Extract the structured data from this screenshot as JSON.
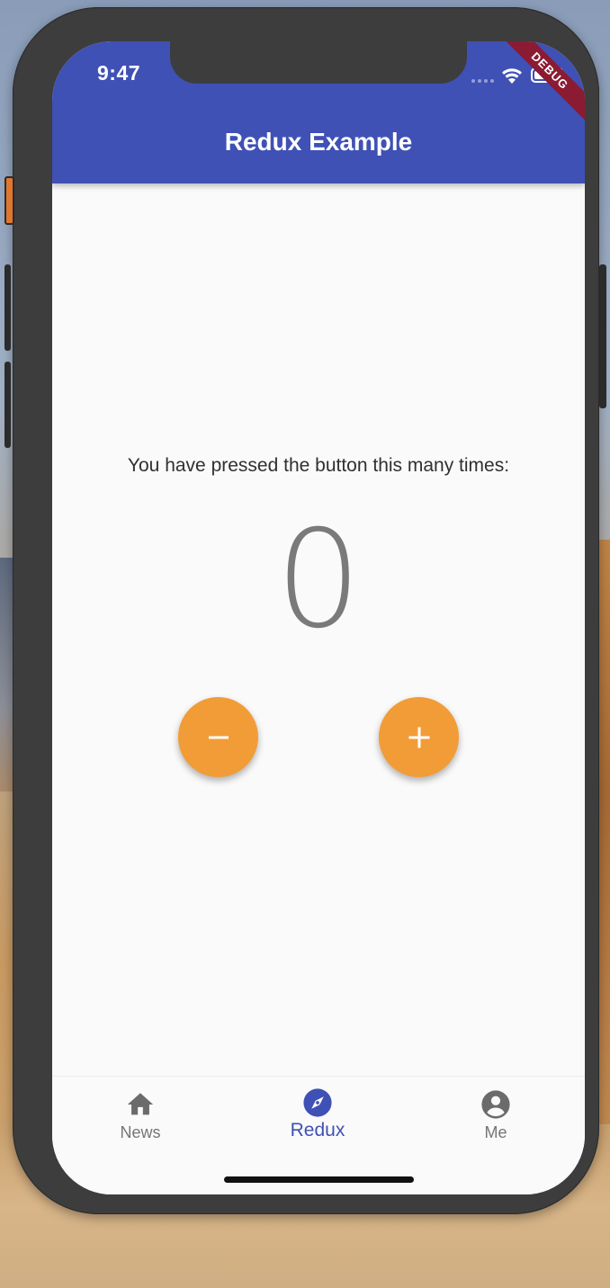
{
  "status_bar": {
    "time": "9:47",
    "icons": [
      "signal-icon",
      "wifi-icon",
      "battery-icon"
    ]
  },
  "debug_banner": "DEBUG",
  "app_bar": {
    "title": "Redux Example"
  },
  "counter": {
    "caption": "You have pressed the button this many times:",
    "value": "0"
  },
  "actions": {
    "decrement_icon": "minus-icon",
    "increment_icon": "plus-icon"
  },
  "bottom_nav": {
    "items": [
      {
        "label": "News",
        "icon": "home-icon",
        "active": false
      },
      {
        "label": "Redux",
        "icon": "compass-icon",
        "active": true
      },
      {
        "label": "Me",
        "icon": "account-circle-icon",
        "active": false
      }
    ]
  },
  "colors": {
    "primary": "#3f51b5",
    "accent": "#f29c37",
    "debug_banner": "#8b1b33",
    "inactive_nav": "#757575"
  }
}
